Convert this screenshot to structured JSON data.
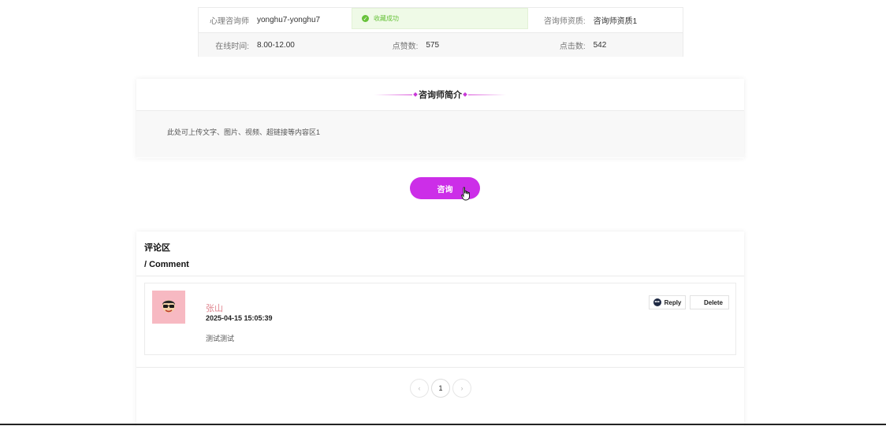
{
  "info": {
    "row1": {
      "counselor_label": "心理咨询师",
      "counselor_value": "yonghu7-yonghu7",
      "qualification_label": "咨询师资质:",
      "qualification_value": "咨询师资质1"
    },
    "row2": {
      "online_label": "在线时间:",
      "online_value": "8.00-12.00",
      "likes_label": "点赞数:",
      "likes_value": "575",
      "clicks_label": "点击数:",
      "clicks_value": "542"
    }
  },
  "toast": {
    "message": "收藏成功"
  },
  "intro": {
    "title": "咨询师简介",
    "body": "此处可上传文字、图片、视频、超链接等内容区1"
  },
  "consult_button": {
    "label": "咨询"
  },
  "comments": {
    "title": "评论区",
    "subtitle": "/ Comment",
    "items": [
      {
        "name": "张山",
        "time": "2025-04-15 15:05:39",
        "text": "测试测试"
      }
    ],
    "reply_label": "Reply",
    "delete_label": "Delete"
  },
  "pagination": {
    "prev": "‹",
    "current": "1",
    "next": "›"
  },
  "colors": {
    "accent": "#cc2ee8",
    "success": "#67c23a",
    "avatar_bg": "#f7b9c2"
  }
}
